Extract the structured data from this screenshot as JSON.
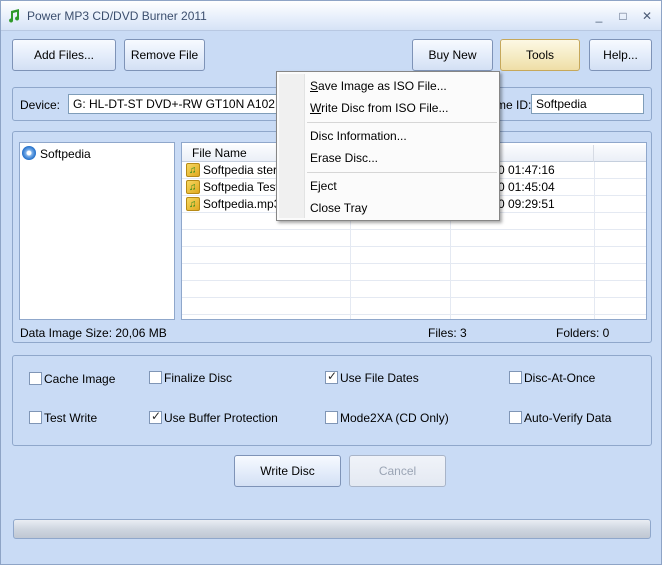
{
  "window": {
    "title": "Power MP3 CD/DVD Burner 2011"
  },
  "title_controls": {
    "minimize": "_",
    "maximize": "□",
    "close": "✕"
  },
  "toolbar": {
    "add_files": "Add Files...",
    "remove_file": "Remove File",
    "buy_new": "Buy New",
    "tools": "Tools",
    "help": "Help..."
  },
  "device": {
    "label": "Device:",
    "value": "G: HL-DT-ST DVD+-RW GT10N A102",
    "volume_label_fragment": "me ID:",
    "volume_value": "Softpedia"
  },
  "tree": {
    "root": "Softpedia"
  },
  "file_list": {
    "columns": [
      "File Name",
      "",
      ""
    ],
    "rows": [
      {
        "name": "Softpedia stere",
        "time": "0 01:47:16"
      },
      {
        "name": "Softpedia Test.",
        "time": "0 01:45:04"
      },
      {
        "name": "Softpedia.mp3",
        "time": "0 09:29:51"
      }
    ]
  },
  "status": {
    "data_size": "Data Image Size: 20,06 MB",
    "files": "Files: 3",
    "folders": "Folders: 0"
  },
  "options": [
    {
      "label": "Cache Image",
      "checked": false
    },
    {
      "label": "Finalize Disc",
      "checked": false
    },
    {
      "label": "Use File Dates",
      "checked": true
    },
    {
      "label": "Disc-At-Once",
      "checked": false
    },
    {
      "label": "Test Write",
      "checked": false
    },
    {
      "label": "Use Buffer Protection",
      "checked": true
    },
    {
      "label": "Mode2XA (CD Only)",
      "checked": false
    },
    {
      "label": "Auto-Verify Data",
      "checked": false
    }
  ],
  "actions": {
    "write_disc": "Write Disc",
    "cancel": "Cancel"
  },
  "tools_menu": {
    "save_iso_prefix": "S",
    "save_iso_rest": "ave Image as ISO File...",
    "write_iso_prefix": "W",
    "write_iso_rest": "rite Disc from ISO File...",
    "disc_info": "Disc Information...",
    "erase_disc": "Erase Disc...",
    "eject": "Eject",
    "close_tray": "Close Tray"
  },
  "colors": {
    "window_bg": "#c9dbf5",
    "accent_border": "#8fa7cb",
    "tools_highlight": "#f5ebc3"
  }
}
